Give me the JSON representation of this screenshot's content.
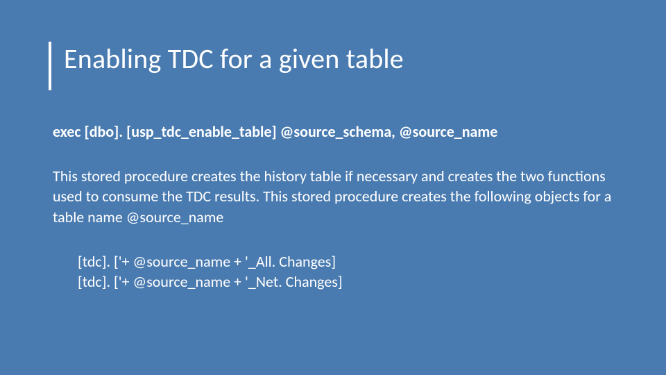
{
  "slide": {
    "title": "Enabling TDC for a given table",
    "exec_line": "exec [dbo]. [usp_tdc_enable_table] @source_schema, @source_name",
    "body": "This stored procedure creates the history table if necessary and creates the two functions used to consume the TDC results. This stored procedure creates the following objects for a table name @source_name",
    "objects": [
      "[tdc]. ['+ @source_name + '_All. Changes]",
      "[tdc]. ['+ @source_name + '_Net. Changes]"
    ]
  }
}
